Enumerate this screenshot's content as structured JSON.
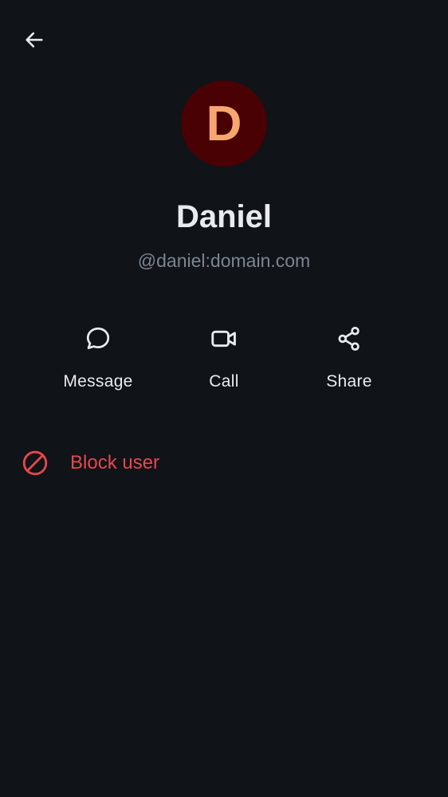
{
  "header": {
    "back_icon": "arrow-left-icon"
  },
  "profile": {
    "avatar_letter": "D",
    "avatar_bg": "#4a0103",
    "avatar_fg": "#f6a770",
    "display_name": "Daniel",
    "user_id": "@daniel:domain.com"
  },
  "actions": [
    {
      "label": "Message",
      "icon": "chat-bubble-icon"
    },
    {
      "label": "Call",
      "icon": "video-camera-icon"
    },
    {
      "label": "Share",
      "icon": "share-icon"
    }
  ],
  "block": {
    "label": "Block user",
    "icon": "block-icon",
    "color": "#e5484d"
  },
  "colors": {
    "background": "#101317",
    "primary_text": "#e8ebf0",
    "secondary_text": "#7d8591"
  }
}
